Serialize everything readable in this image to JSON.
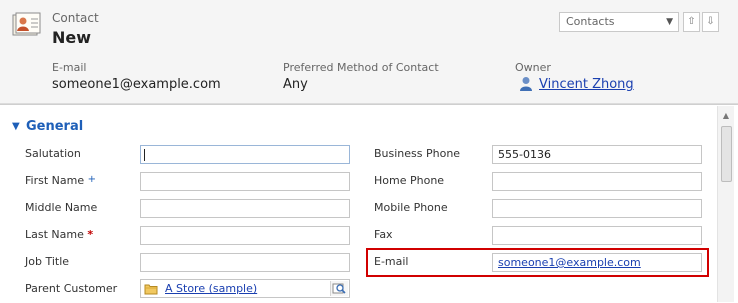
{
  "header": {
    "entity_type": "Contact",
    "record_title": "New",
    "view_selector": "Contacts",
    "fields": [
      {
        "label": "E-mail",
        "value": "someone1@example.com"
      },
      {
        "label": "Preferred Method of Contact",
        "value": "Any"
      },
      {
        "label": "Owner",
        "value": "Vincent Zhong"
      }
    ]
  },
  "section": {
    "title": "General"
  },
  "form": {
    "left": [
      {
        "label": "Salutation",
        "value": ""
      },
      {
        "label": "First Name",
        "value": ""
      },
      {
        "label": "Middle Name",
        "value": ""
      },
      {
        "label": "Last Name",
        "value": ""
      },
      {
        "label": "Job Title",
        "value": ""
      },
      {
        "label": "Parent Customer",
        "value": "A Store (sample)"
      }
    ],
    "right": [
      {
        "label": "Business Phone",
        "value": "555-0136"
      },
      {
        "label": "Home Phone",
        "value": ""
      },
      {
        "label": "Mobile Phone",
        "value": ""
      },
      {
        "label": "Fax",
        "value": ""
      },
      {
        "label": "E-mail",
        "value": "someone1@example.com"
      }
    ],
    "markers": {
      "required": "*",
      "recommended": "+"
    }
  },
  "colors": {
    "section_title": "#1e5fb8",
    "link": "#1a3fb0",
    "required": "#c00000",
    "highlight": "#d10000"
  }
}
